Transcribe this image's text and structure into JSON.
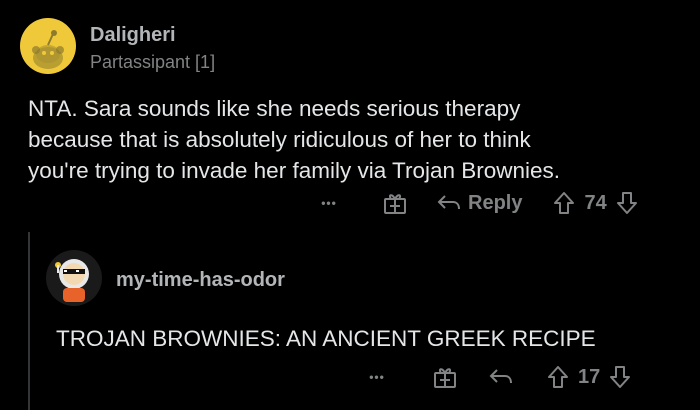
{
  "comments": [
    {
      "author": "Daligheri",
      "flair": "Partassipant [1]",
      "body_lines": [
        "NTA. Sara sounds like she needs serious therapy",
        "because that is absolutely ridiculous of her to think",
        "you're trying to invade her family via Trojan Brownies."
      ],
      "actions": {
        "more": "•••",
        "reply": "Reply",
        "votes": "74"
      }
    },
    {
      "author": "my-time-has-odor",
      "body": "TROJAN BROWNIES: AN ANCIENT GREEK RECIPE",
      "actions": {
        "more": "•••",
        "votes": "17"
      }
    }
  ],
  "colors": {
    "avatar1_bg": "#f0c93b",
    "text": "#e4e6e8",
    "muted": "#818384",
    "thread": "#343536"
  }
}
